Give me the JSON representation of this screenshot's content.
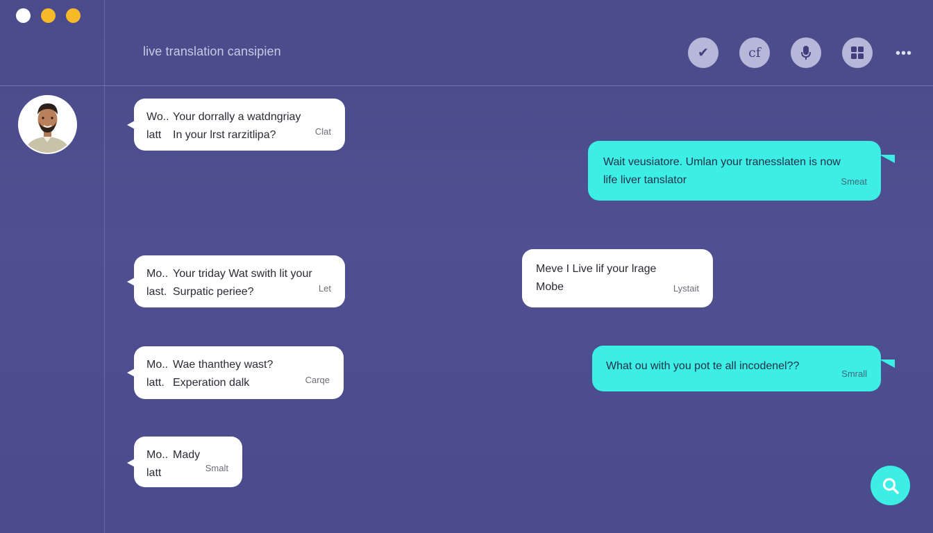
{
  "window": {
    "title": "live translation cansipien"
  },
  "toolbar": [
    {
      "name": "check-icon",
      "glyph": "✔"
    },
    {
      "name": "translate-icon",
      "glyph": "cf"
    },
    {
      "name": "microphone-icon",
      "glyph": "🎙"
    },
    {
      "name": "grid-icon",
      "glyph": "▦"
    }
  ],
  "more_glyph": "•••",
  "messages": [
    {
      "side": "in",
      "line1_prefix": "Wo..",
      "line1": "Your dorrally a watdngriay",
      "line2_prefix": "latt",
      "line2": "In your lrst rarzitlipa?",
      "meta": "Clat"
    },
    {
      "side": "out",
      "line1": "Wait veusiatore. Umlan your tranesslaten is now",
      "line2": "life liver tanslator",
      "meta": "Smeat"
    },
    {
      "side": "in",
      "line1_prefix": "Mo..",
      "line1": "Your triday Wat swith lit your",
      "line2_prefix": "last.",
      "line2": "Surpatic periee?",
      "meta": "Let"
    },
    {
      "side": "in",
      "line1": "Meve I Live lif your lrage",
      "line2": "Mobe",
      "meta": "Lystait"
    },
    {
      "side": "in",
      "line1_prefix": "Mo..",
      "line1": "Wae thanthey wast?",
      "line2_prefix": "latt.",
      "line2": "Experation dalk",
      "meta": "Carqe"
    },
    {
      "side": "out",
      "line1": "What ou with you pot te all incodenel??",
      "line2": "",
      "meta": "Smrall"
    },
    {
      "side": "in",
      "line1_prefix": "Mo..",
      "line1": "Mady",
      "line2_prefix": "latt",
      "line2": "",
      "meta": "Smalt"
    }
  ],
  "colors": {
    "background": "#4e4f8f",
    "accent": "#3ceee4",
    "bubble_in": "#ffffff",
    "traffic_yellow": "#f5b92a"
  }
}
